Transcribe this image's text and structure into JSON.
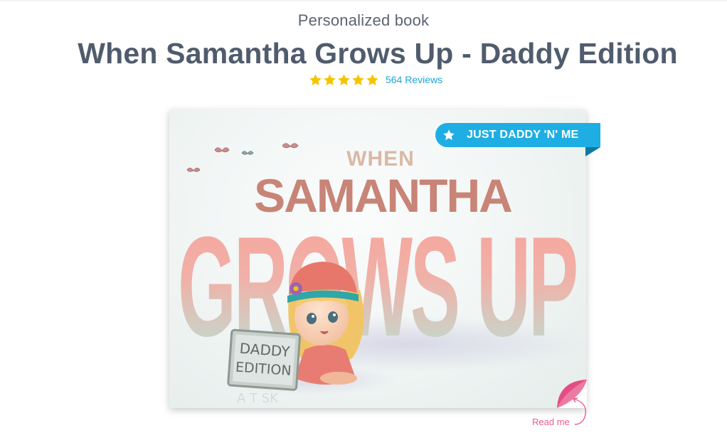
{
  "header": {
    "subtitle": "Personalized book",
    "title": "When Samantha Grows Up - Daddy Edition"
  },
  "rating": {
    "stars": 5,
    "reviews_label": "564 Reviews",
    "star_color": "#f5c400"
  },
  "cover": {
    "word_when": "WHEN",
    "name": "SAMANTHA",
    "word_grows_up": "GROWS UP",
    "sign_line1": "DADDY",
    "sign_line2": "EDITION",
    "floor_letters": "A  T  SK",
    "badge_label": "JUST DADDY 'N' ME",
    "badge_icon": "star-icon",
    "badge_color": "#1eaee3"
  },
  "read_me": {
    "label": "Read me",
    "color": "#ec5b8b"
  }
}
